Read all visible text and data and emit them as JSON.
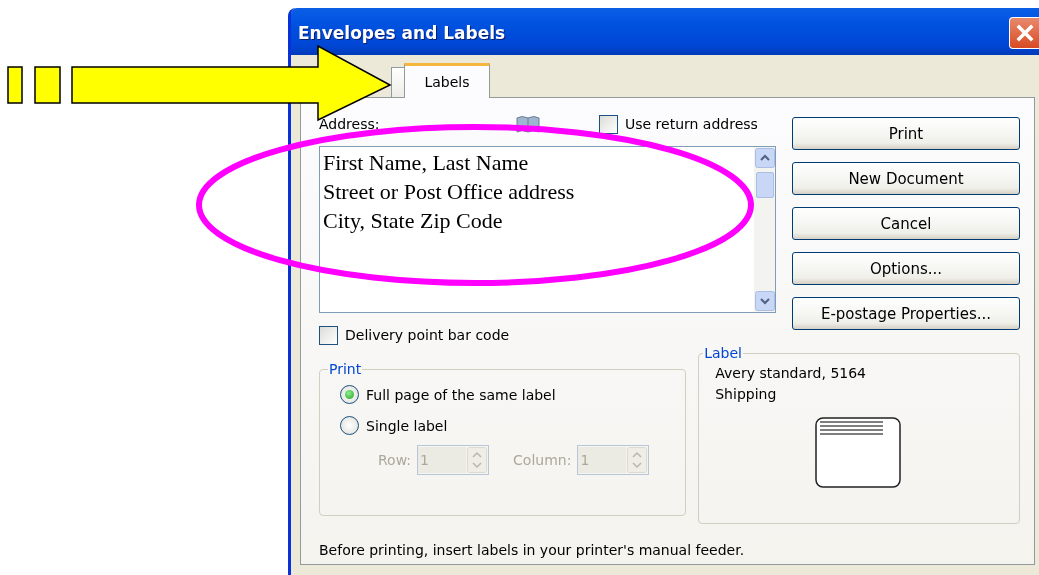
{
  "window": {
    "title": "Envelopes and Labels"
  },
  "tabs": [
    {
      "selected": false
    },
    {
      "label": "Labels",
      "selected": true
    }
  ],
  "address": {
    "label": "Address:",
    "lines": [
      "First Name, Last Name",
      "Street or Post Office address",
      "City, State Zip Code"
    ]
  },
  "use_return_address": {
    "label": "Use return address",
    "checked": false
  },
  "buttons": [
    "Print",
    "New Document",
    "Cancel",
    "Options...",
    "E-postage Properties..."
  ],
  "delivery_point_bar_code": {
    "label": "Delivery point bar code",
    "checked": false
  },
  "print_group": {
    "title": "Print",
    "options": [
      {
        "label": "Full page of the same label",
        "selected": true
      },
      {
        "label": "Single label",
        "selected": false
      }
    ],
    "fields": [
      {
        "label": "Row:",
        "value": "1",
        "disabled": true
      },
      {
        "label": "Column:",
        "value": "1",
        "disabled": true
      }
    ]
  },
  "label_group": {
    "title": "Label",
    "lines": [
      "Avery standard, 5164",
      "Shipping"
    ]
  },
  "footer": "Before printing, insert labels in your printer's manual feeder.",
  "annotations": [
    {
      "kind": "dash"
    },
    {
      "kind": "dash"
    },
    {
      "kind": "arrow"
    },
    {
      "kind": "ellipse"
    }
  ]
}
